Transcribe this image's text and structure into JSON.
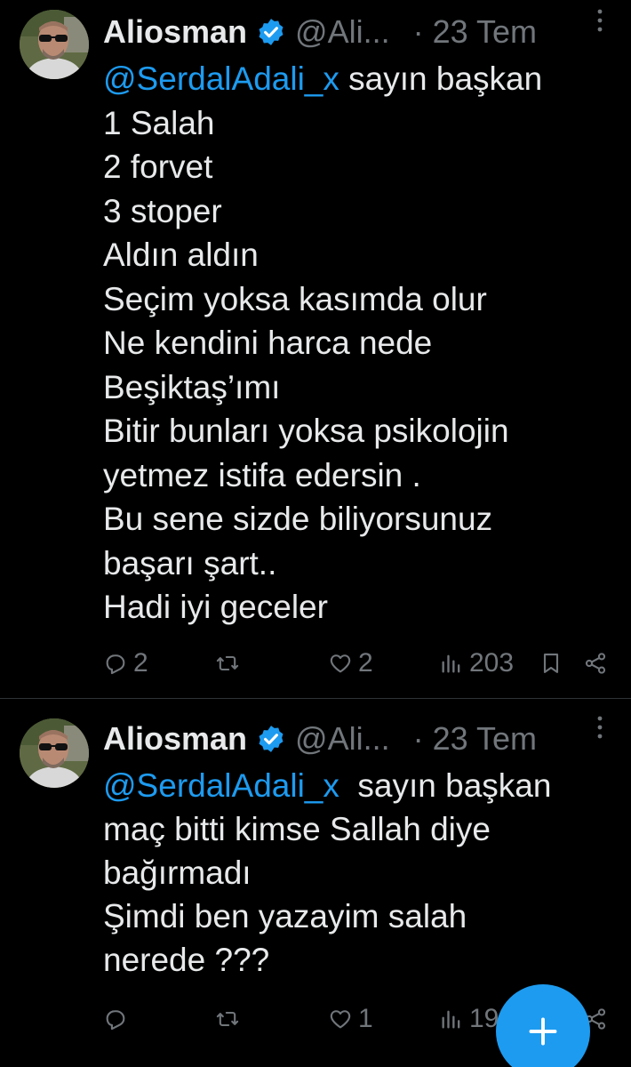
{
  "tweets": [
    {
      "author_name": "Aliosman",
      "handle": "@Ali...",
      "separator": "·",
      "date": "23 Tem",
      "mention": "@SerdalAdali_x",
      "first_line_rest": " sayın başkan",
      "lines": [
        "1 Salah",
        "2 forvet",
        "3 stoper",
        "Aldın aldın",
        "Seçim yoksa kasımda olur",
        "Ne kendini harca nede",
        "Beşiktaş’ımı",
        "Bitir bunları yoksa psikolojin",
        "yetmez istifa edersin .",
        "Bu sene sizde biliyorsunuz",
        "başarı şart..",
        "Hadi iyi geceler"
      ],
      "reply_count": "2",
      "retweet_count": "",
      "like_count": "2",
      "view_count": "203"
    },
    {
      "author_name": "Aliosman",
      "handle": "@Ali...",
      "separator": "·",
      "date": "23 Tem",
      "mention": "@SerdalAdali_x",
      "first_line_rest": "  sayın başkan",
      "lines": [
        "maç bitti kimse Sallah diye",
        "bağırmadı",
        "Şimdi ben yazayim salah",
        "nerede ???"
      ],
      "reply_count": "",
      "retweet_count": "",
      "like_count": "1",
      "view_count": "19"
    }
  ],
  "icons": {
    "verified": "verified-badge-icon",
    "more": "more-vertical-icon",
    "reply": "reply-icon",
    "retweet": "retweet-icon",
    "like": "heart-icon",
    "views": "views-icon",
    "bookmark": "bookmark-icon",
    "share": "share-icon",
    "compose": "plus-icon"
  },
  "colors": {
    "background": "#000000",
    "text": "#e7e9ea",
    "muted": "#71767b",
    "accent": "#1d9bf0"
  }
}
